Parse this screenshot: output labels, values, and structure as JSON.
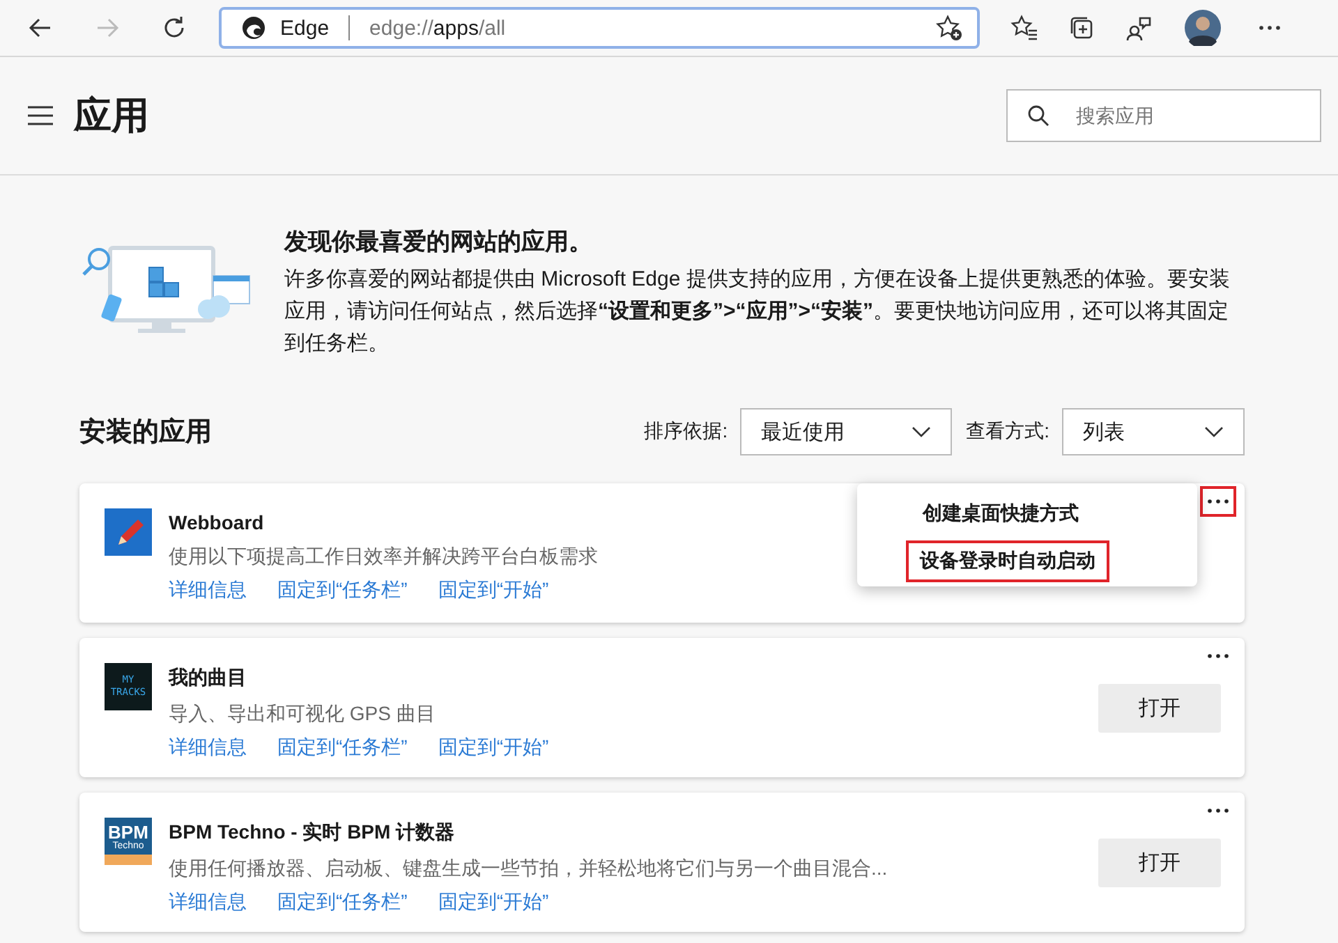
{
  "browser": {
    "site_name": "Edge",
    "address": {
      "scheme": "edge://",
      "host": "apps",
      "path": "/all"
    }
  },
  "header": {
    "title": "应用",
    "search": {
      "placeholder": "搜索应用"
    }
  },
  "intro": {
    "heading": "发现你最喜爱的网站的应用。",
    "text": "许多你喜爱的网站都提供由 Microsoft Edge 提供支持的应用，方便在设备上提供更熟悉的体验。要安装应用，请访问任何站点，然后选择**“设置和更多”>“应用”>“安装”**。要更快地访问应用，还可以将其固定到任务栏。"
  },
  "installed": {
    "heading": "安装的应用",
    "sort_label": "排序依据:",
    "sort_value": "最近使用",
    "view_label": "查看方式:",
    "view_value": "列表"
  },
  "apps": [
    {
      "kind": "pencil",
      "name": "Webboard",
      "description": "使用以下项提高工作日效率并解决跨平台白板需求",
      "links": [
        "详细信息",
        "固定到“任务栏”",
        "固定到“开始”"
      ],
      "more_highlighted": true,
      "menu": [
        {
          "label": "创建桌面快捷方式",
          "highlighted": false
        },
        {
          "label": "设备登录时自动启动",
          "highlighted": true
        }
      ]
    },
    {
      "kind": "tracks",
      "icon_text": "MY TRACKS",
      "name": "我的曲目",
      "description": "导入、导出和可视化 GPS 曲目",
      "links": [
        "详细信息",
        "固定到“任务栏”",
        "固定到“开始”"
      ],
      "more_highlighted": false,
      "button": "打开"
    },
    {
      "kind": "bpm",
      "icon_text": [
        "BPM",
        "Techno"
      ],
      "name": "BPM Techno - 实时 BPM 计数器",
      "description": "使用任何播放器、启动板、键盘生成一些节拍，并轻松地将它们与另一个曲目混合...",
      "links": [
        "详细信息",
        "固定到“任务栏”",
        "固定到“开始”"
      ],
      "more_highlighted": false,
      "button": "打开"
    }
  ]
}
